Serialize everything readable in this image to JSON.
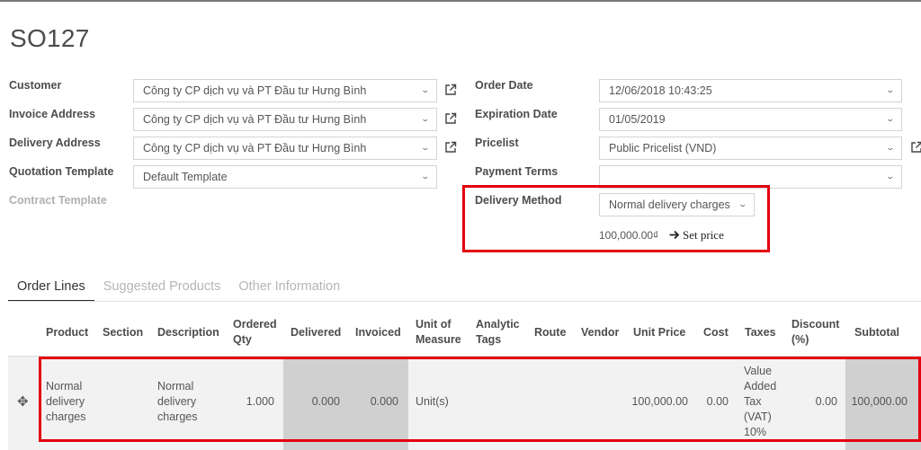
{
  "record": {
    "title": "SO127"
  },
  "left_fields": {
    "customer": {
      "label": "Customer",
      "value": "Công ty CP dịch vụ và PT Đầu tư Hưng Bình"
    },
    "invoice_address": {
      "label": "Invoice Address",
      "value": "Công ty CP dịch vụ và PT Đầu tư Hưng Bình"
    },
    "delivery_address": {
      "label": "Delivery Address",
      "value": "Công ty CP dịch vụ và PT Đầu tư Hưng Bình"
    },
    "quotation_template": {
      "label": "Quotation Template",
      "value": "Default Template"
    },
    "contract_template": {
      "label": "Contract Template"
    }
  },
  "right_fields": {
    "order_date": {
      "label": "Order Date",
      "value": "12/06/2018 10:43:25"
    },
    "expiration_date": {
      "label": "Expiration Date",
      "value": "01/05/2019"
    },
    "pricelist": {
      "label": "Pricelist",
      "value": "Public Pricelist (VND)"
    },
    "payment_terms": {
      "label": "Payment Terms",
      "value": ""
    },
    "delivery_method": {
      "label": "Delivery Method",
      "value": "Normal delivery charges",
      "price": "100,000.00₫",
      "set_price_label": "Set price"
    }
  },
  "tabs": [
    {
      "label": "Order Lines",
      "active": true
    },
    {
      "label": "Suggested Products",
      "active": false
    },
    {
      "label": "Other Information",
      "active": false
    }
  ],
  "table": {
    "headers": {
      "product": "Product",
      "section": "Section",
      "description": "Description",
      "ordered_qty_1": "Ordered",
      "ordered_qty_2": "Qty",
      "delivered": "Delivered",
      "invoiced": "Invoiced",
      "uom_1": "Unit of",
      "uom_2": "Measure",
      "analytic_1": "Analytic",
      "analytic_2": "Tags",
      "route": "Route",
      "vendor": "Vendor",
      "unit_price": "Unit Price",
      "cost": "Cost",
      "taxes": "Taxes",
      "discount_1": "Discount",
      "discount_2": "(%)",
      "subtotal": "Subtotal"
    },
    "rows": [
      {
        "product": [
          "Normal",
          "delivery",
          "charges"
        ],
        "description": [
          "Normal",
          "delivery",
          "charges"
        ],
        "ordered_qty": "1.000",
        "delivered": "0.000",
        "invoiced": "0.000",
        "uom": "Unit(s)",
        "unit_price": "100,000.00",
        "cost": "0.00",
        "taxes": [
          "Value",
          "Added",
          "Tax",
          "(VAT)",
          "10%"
        ],
        "discount": "0.00",
        "subtotal": "100,000.00"
      }
    ]
  },
  "colors": {
    "highlight_border": "#e3000f",
    "grey_column": "#d0d0d0",
    "row_bg": "#f2f2f2"
  }
}
